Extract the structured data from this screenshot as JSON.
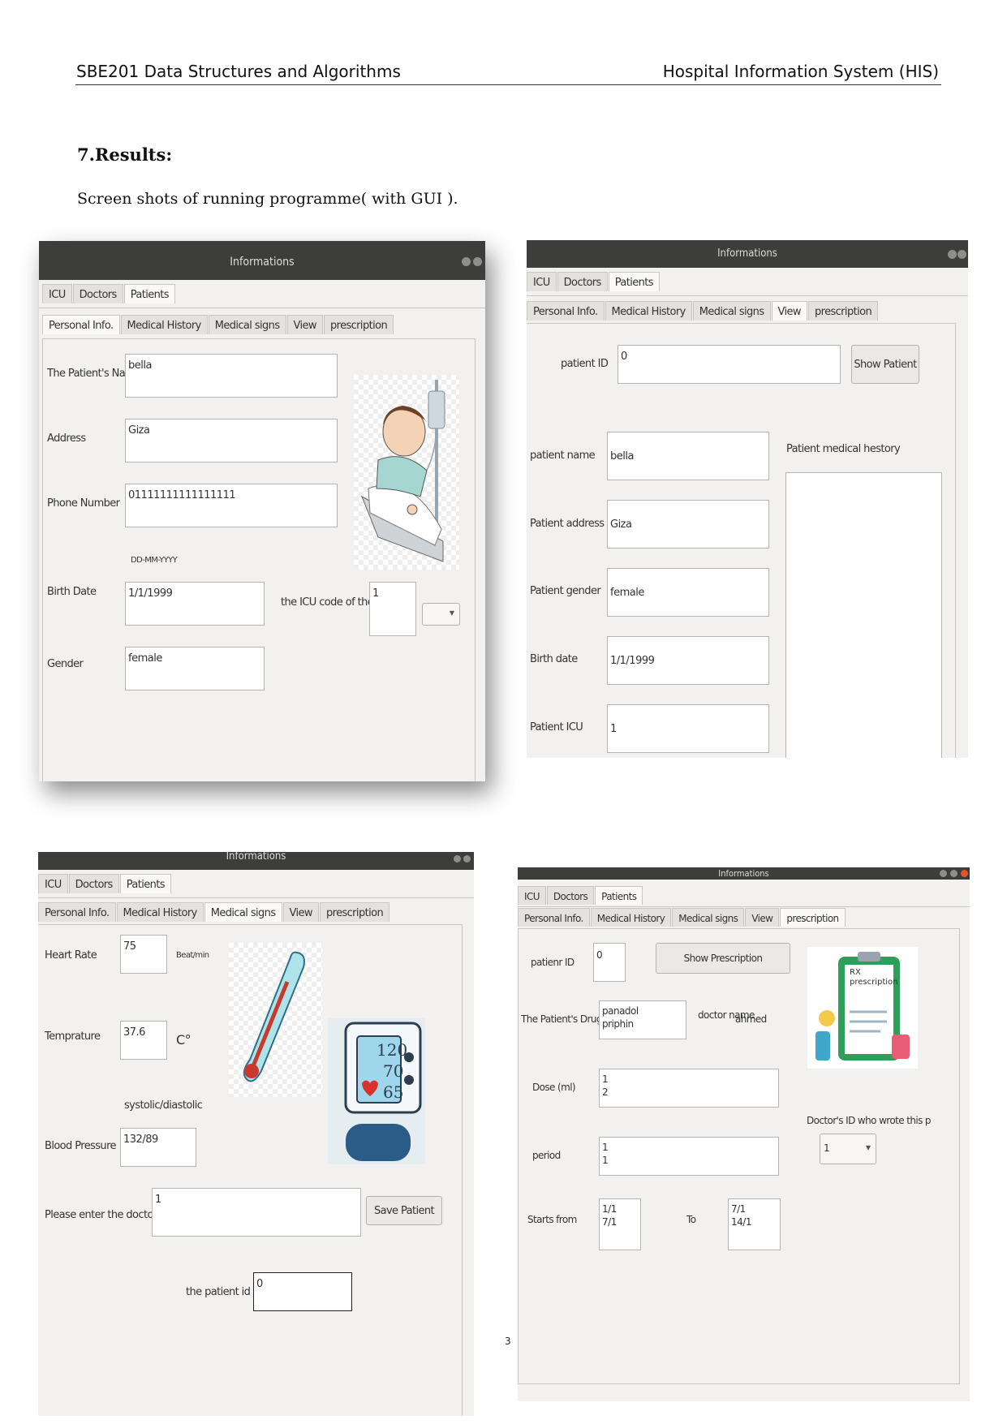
{
  "header": {
    "left": "SBE201 Data Structures and Algorithms",
    "right": "Hospital Information System (HIS)"
  },
  "heading": "7.Results:",
  "intro": "Screen shots of running programme( with GUI ).",
  "page_number": "3",
  "tabs_top": [
    "ICU",
    "Doctors",
    "Patients"
  ],
  "tabs_sub": [
    "Personal Info.",
    "Medical History",
    "Medical signs",
    "View",
    "prescription"
  ],
  "window_title": "Informations",
  "screen1": {
    "name_label": "The Patient's Name",
    "name_value": "bella",
    "address_label": "Address",
    "address_value": "Giza",
    "phone_label": "Phone Number",
    "phone_value": "01111111111111111",
    "date_hint": "DD-MM-YYYY",
    "birth_label": "Birth Date",
    "birth_value": "1/1/1999",
    "icu_label": "the ICU code of the pati",
    "icu_value": "1",
    "gender_label": "Gender",
    "gender_value": "female",
    "image": "patient-in-bed-illustration"
  },
  "screen2": {
    "id_label": "patient ID",
    "id_value": "0",
    "show_button": "Show Patient",
    "name_label": "patient name",
    "name_value": "bella",
    "address_label": "Patient address",
    "address_value": "Giza",
    "gender_label": "Patient  gender",
    "gender_value": "female",
    "birth_label": "Birth date",
    "birth_value": "1/1/1999",
    "icu_label": "Patient ICU",
    "icu_value": "1",
    "history_label": "Patient medical hestory"
  },
  "screen3": {
    "heart_label": "Heart Rate",
    "heart_value": "75",
    "heart_unit": "Beat/min",
    "temp_label": "Temprature",
    "temp_value": "37.6",
    "temp_unit": "C°",
    "bp_hint": "systolic/diastolic",
    "bp_label": "Blood Pressure",
    "bp_value": "132/89",
    "doctor_label": "Please enter the doctor's ID",
    "doctor_value": "1",
    "save_button": "Save Patient",
    "pid_label": "the patient id is",
    "pid_value": "0",
    "bp_monitor": {
      "sys": "120",
      "dia": "70",
      "pulse": "65"
    }
  },
  "screen4": {
    "id_label": "patienr ID",
    "id_value": "0",
    "show_button": "Show Prescription",
    "drugs_label": "The Patient's Drugs",
    "drugs_value": "panadol\npriphin",
    "doctor_name_label": "doctor name",
    "doctor_name_value": "ahmed",
    "dose_label": "Dose (ml)",
    "dose_value": "1\n2",
    "doctor_id_label": "Doctor's ID who wrote this p",
    "doctor_id_value": "1",
    "period_label": "period",
    "period_value": "1\n1",
    "starts_label": "Starts from",
    "starts_value": "1/1\n7/1",
    "to_label": "To",
    "to_value": "7/1\n14/1",
    "rx_title": "RX",
    "rx_sub": "prescription"
  },
  "colors": {
    "titlebar": "#3d3d3b",
    "window_bg": "#f2f1ef",
    "close_red": "#e2552d"
  }
}
